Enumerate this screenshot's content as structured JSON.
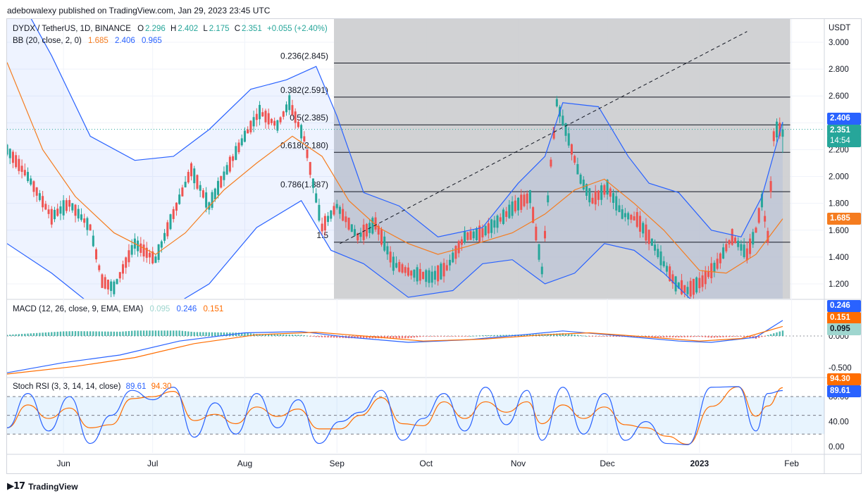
{
  "header": {
    "publisher_text": "adebowalexy published on TradingView.com, Jan 29, 2023 23:45 UTC"
  },
  "footer": {
    "brand": "TradingView"
  },
  "colors": {
    "up": "#26a69a",
    "down": "#ef5350",
    "bb_mid": "#f57c1f",
    "bb_band": "#2962ff",
    "macd": "#2962ff",
    "signal": "#ff6d00",
    "stoch_k": "#2962ff",
    "stoch_d": "#ff6d00",
    "fib_zone": "#c9cacc"
  },
  "main_legend": {
    "symbol": "DYDX / TetherUS, 1D, BINANCE",
    "o_label": "O",
    "o": "2.296",
    "h_label": "H",
    "h": "2.402",
    "l_label": "L",
    "l": "2.175",
    "c_label": "C",
    "c": "2.351",
    "change": "+0.055 (+2.40%)",
    "bb_label": "BB (20, close, 2, 0)",
    "bb_mid": "1.685",
    "bb_upper": "2.406",
    "bb_lower": "0.965"
  },
  "macd_legend": {
    "label": "MACD (12, 26, close, 9, EMA, EMA)",
    "hist": "0.095",
    "macd": "0.246",
    "signal": "0.151"
  },
  "stoch_legend": {
    "label": "Stoch RSI (3, 3, 14, 14, close)",
    "k": "89.61",
    "d": "94.30"
  },
  "price_axis": {
    "unit": "USDT",
    "ticks": [
      "3.000",
      "2.800",
      "2.600",
      "2.400",
      "2.200",
      "2.000",
      "1.800",
      "1.600",
      "1.400",
      "1.200"
    ],
    "tick_values": [
      3.0,
      2.8,
      2.6,
      2.4,
      2.2,
      2.0,
      1.8,
      1.6,
      1.4,
      1.2
    ]
  },
  "macd_axis": {
    "ticks": [
      "0.000",
      "-0.500"
    ],
    "tick_values": [
      0.0,
      -0.5
    ]
  },
  "stoch_axis": {
    "ticks": [
      "80.00",
      "40.00",
      "0.00"
    ],
    "tick_values": [
      80,
      40,
      0
    ],
    "bands": [
      80,
      50,
      20
    ]
  },
  "price_labels": {
    "bb_upper": "2.406",
    "close": "2.351",
    "countdown": "14:54",
    "bb_mid": "1.685",
    "macd": "0.246",
    "signal": "0.151",
    "hist": "0.095",
    "stoch_d": "94.30",
    "stoch_k": "89.61"
  },
  "time_axis": {
    "labels": [
      "Jun",
      "Jul",
      "Aug",
      "Sep",
      "Oct",
      "Nov",
      "Dec",
      "2023",
      "Feb"
    ],
    "dates": [
      "2022-06-01",
      "2022-07-01",
      "2022-08-01",
      "2022-09-01",
      "2022-10-01",
      "2022-11-01",
      "2022-12-01",
      "2023-01-01",
      "2023-02-01"
    ]
  },
  "fib_levels": [
    {
      "label": "0.236(2.845)",
      "value": 2.845
    },
    {
      "label": "0.382(2.591)",
      "value": 2.591
    },
    {
      "label": "0.5(2.385)",
      "value": 2.385
    },
    {
      "label": "0.618(2.180)",
      "value": 2.18
    },
    {
      "label": "0.786(1.887)",
      "value": 1.887
    },
    {
      "label": "1.5",
      "value": 1.51
    }
  ],
  "chart_data": {
    "type": "candlestick",
    "symbol": "DYDX / TetherUS",
    "interval": "1D",
    "y_range": [
      1.15,
      3.1
    ],
    "date_range": [
      "2022-05-13",
      "2023-01-29"
    ],
    "last": {
      "open": 2.296,
      "high": 2.402,
      "low": 2.175,
      "close": 2.351
    },
    "close_path": [
      [
        "2022-05-13",
        2.2
      ],
      [
        "2022-05-20",
        2.0
      ],
      [
        "2022-05-28",
        1.7
      ],
      [
        "2022-06-03",
        1.8
      ],
      [
        "2022-06-10",
        1.62
      ],
      [
        "2022-06-14",
        1.22
      ],
      [
        "2022-06-18",
        1.17
      ],
      [
        "2022-06-25",
        1.5
      ],
      [
        "2022-07-02",
        1.38
      ],
      [
        "2022-07-08",
        1.72
      ],
      [
        "2022-07-14",
        2.05
      ],
      [
        "2022-07-20",
        1.78
      ],
      [
        "2022-07-26",
        2.05
      ],
      [
        "2022-08-01",
        2.3
      ],
      [
        "2022-08-06",
        2.48
      ],
      [
        "2022-08-12",
        2.38
      ],
      [
        "2022-08-16",
        2.55
      ],
      [
        "2022-08-21",
        2.28
      ],
      [
        "2022-08-27",
        1.62
      ],
      [
        "2022-09-01",
        1.78
      ],
      [
        "2022-09-08",
        1.55
      ],
      [
        "2022-09-14",
        1.65
      ],
      [
        "2022-09-20",
        1.35
      ],
      [
        "2022-09-26",
        1.28
      ],
      [
        "2022-10-03",
        1.25
      ],
      [
        "2022-10-08",
        1.32
      ],
      [
        "2022-10-14",
        1.55
      ],
      [
        "2022-10-20",
        1.58
      ],
      [
        "2022-10-26",
        1.68
      ],
      [
        "2022-10-31",
        1.78
      ],
      [
        "2022-11-05",
        1.85
      ],
      [
        "2022-11-09",
        1.3
      ],
      [
        "2022-11-12",
        2.1
      ],
      [
        "2022-11-14",
        2.55
      ],
      [
        "2022-11-17",
        2.35
      ],
      [
        "2022-11-22",
        1.98
      ],
      [
        "2022-11-26",
        1.82
      ],
      [
        "2022-12-01",
        1.92
      ],
      [
        "2022-12-06",
        1.72
      ],
      [
        "2022-12-11",
        1.68
      ],
      [
        "2022-12-15",
        1.55
      ],
      [
        "2022-12-20",
        1.35
      ],
      [
        "2022-12-24",
        1.2
      ],
      [
        "2022-12-28",
        1.15
      ],
      [
        "2023-01-02",
        1.22
      ],
      [
        "2023-01-07",
        1.35
      ],
      [
        "2023-01-12",
        1.55
      ],
      [
        "2023-01-17",
        1.42
      ],
      [
        "2023-01-20",
        1.6
      ],
      [
        "2023-01-22",
        1.82
      ],
      [
        "2023-01-24",
        1.55
      ],
      [
        "2023-01-26",
        2.3
      ],
      [
        "2023-01-27",
        2.35
      ],
      [
        "2023-01-29",
        2.351
      ]
    ],
    "bollinger_mid": [
      [
        "2022-05-13",
        2.85
      ],
      [
        "2022-05-25",
        2.2
      ],
      [
        "2022-06-05",
        1.85
      ],
      [
        "2022-06-18",
        1.58
      ],
      [
        "2022-07-02",
        1.42
      ],
      [
        "2022-07-12",
        1.58
      ],
      [
        "2022-07-25",
        1.9
      ],
      [
        "2022-08-05",
        2.1
      ],
      [
        "2022-08-17",
        2.3
      ],
      [
        "2022-08-27",
        2.15
      ],
      [
        "2022-09-05",
        1.82
      ],
      [
        "2022-09-15",
        1.62
      ],
      [
        "2022-09-25",
        1.5
      ],
      [
        "2022-10-05",
        1.42
      ],
      [
        "2022-10-15",
        1.48
      ],
      [
        "2022-10-30",
        1.58
      ],
      [
        "2022-11-10",
        1.72
      ],
      [
        "2022-11-20",
        1.9
      ],
      [
        "2022-11-30",
        1.98
      ],
      [
        "2022-12-10",
        1.8
      ],
      [
        "2022-12-20",
        1.6
      ],
      [
        "2023-01-01",
        1.3
      ],
      [
        "2023-01-10",
        1.28
      ],
      [
        "2023-01-20",
        1.42
      ],
      [
        "2023-01-29",
        1.685
      ]
    ],
    "bollinger_upper": [
      [
        "2022-05-13",
        3.5
      ],
      [
        "2022-05-28",
        2.9
      ],
      [
        "2022-06-10",
        2.3
      ],
      [
        "2022-06-25",
        2.12
      ],
      [
        "2022-07-08",
        2.15
      ],
      [
        "2022-07-20",
        2.35
      ],
      [
        "2022-08-03",
        2.65
      ],
      [
        "2022-08-15",
        2.72
      ],
      [
        "2022-08-25",
        2.82
      ],
      [
        "2022-09-01",
        2.45
      ],
      [
        "2022-09-10",
        1.88
      ],
      [
        "2022-09-22",
        1.78
      ],
      [
        "2022-10-05",
        1.55
      ],
      [
        "2022-10-20",
        1.62
      ],
      [
        "2022-11-01",
        1.95
      ],
      [
        "2022-11-10",
        2.15
      ],
      [
        "2022-11-16",
        2.55
      ],
      [
        "2022-11-28",
        2.52
      ],
      [
        "2022-12-08",
        2.15
      ],
      [
        "2022-12-15",
        1.95
      ],
      [
        "2022-12-25",
        1.88
      ],
      [
        "2023-01-05",
        1.6
      ],
      [
        "2023-01-15",
        1.55
      ],
      [
        "2023-01-22",
        1.85
      ],
      [
        "2023-01-29",
        2.406
      ]
    ],
    "bollinger_lower": [
      [
        "2022-05-13",
        1.5
      ],
      [
        "2022-05-28",
        1.28
      ],
      [
        "2022-06-10",
        1.05
      ],
      [
        "2022-06-20",
        0.98
      ],
      [
        "2022-07-05",
        1.0
      ],
      [
        "2022-07-20",
        1.2
      ],
      [
        "2022-08-05",
        1.62
      ],
      [
        "2022-08-20",
        1.82
      ],
      [
        "2022-08-30",
        1.45
      ],
      [
        "2022-09-10",
        1.35
      ],
      [
        "2022-09-25",
        1.1
      ],
      [
        "2022-10-10",
        1.15
      ],
      [
        "2022-10-20",
        1.35
      ],
      [
        "2022-10-30",
        1.38
      ],
      [
        "2022-11-10",
        1.2
      ],
      [
        "2022-11-20",
        1.28
      ],
      [
        "2022-11-30",
        1.5
      ],
      [
        "2022-12-10",
        1.45
      ],
      [
        "2022-12-20",
        1.28
      ],
      [
        "2023-01-01",
        1.02
      ],
      [
        "2023-01-15",
        1.0
      ],
      [
        "2023-01-29",
        0.965
      ]
    ],
    "fib_zone": {
      "from_date": "2022-08-31",
      "to_date": "2023-01-29"
    },
    "trend_line": [
      [
        "2022-09-02",
        1.5
      ],
      [
        "2023-01-17",
        3.08
      ]
    ],
    "macd": {
      "y_range": [
        -0.6,
        0.3
      ],
      "macd_line": [
        [
          "2022-05-13",
          -0.58
        ],
        [
          "2022-06-01",
          -0.42
        ],
        [
          "2022-06-20",
          -0.3
        ],
        [
          "2022-07-10",
          -0.08
        ],
        [
          "2022-08-01",
          0.05
        ],
        [
          "2022-08-20",
          0.07
        ],
        [
          "2022-09-05",
          -0.02
        ],
        [
          "2022-09-25",
          -0.1
        ],
        [
          "2022-10-15",
          -0.06
        ],
        [
          "2022-11-05",
          0.03
        ],
        [
          "2022-11-16",
          0.08
        ],
        [
          "2022-12-01",
          0.02
        ],
        [
          "2022-12-25",
          -0.08
        ],
        [
          "2023-01-05",
          -0.1
        ],
        [
          "2023-01-20",
          -0.02
        ],
        [
          "2023-01-29",
          0.246
        ]
      ],
      "signal_line": [
        [
          "2022-05-13",
          -0.6
        ],
        [
          "2022-06-05",
          -0.48
        ],
        [
          "2022-06-25",
          -0.34
        ],
        [
          "2022-07-15",
          -0.12
        ],
        [
          "2022-08-05",
          0.02
        ],
        [
          "2022-08-25",
          0.06
        ],
        [
          "2022-09-10",
          0.0
        ],
        [
          "2022-09-30",
          -0.08
        ],
        [
          "2022-10-20",
          -0.05
        ],
        [
          "2022-11-10",
          0.02
        ],
        [
          "2022-11-25",
          0.05
        ],
        [
          "2022-12-10",
          0.0
        ],
        [
          "2023-01-01",
          -0.08
        ],
        [
          "2023-01-15",
          -0.04
        ],
        [
          "2023-01-29",
          0.151
        ]
      ],
      "histogram_last": 0.095
    },
    "stoch_rsi": {
      "y_range": [
        0,
        100
      ],
      "k_last": 89.61,
      "d_last": 94.3,
      "k_series": [
        [
          "2022-05-13",
          30
        ],
        [
          "2022-05-20",
          85
        ],
        [
          "2022-05-27",
          25
        ],
        [
          "2022-06-03",
          80
        ],
        [
          "2022-06-10",
          5
        ],
        [
          "2022-06-17",
          50
        ],
        [
          "2022-06-24",
          90
        ],
        [
          "2022-07-01",
          75
        ],
        [
          "2022-07-08",
          95
        ],
        [
          "2022-07-15",
          15
        ],
        [
          "2022-07-22",
          70
        ],
        [
          "2022-07-29",
          20
        ],
        [
          "2022-08-05",
          85
        ],
        [
          "2022-08-12",
          30
        ],
        [
          "2022-08-19",
          75
        ],
        [
          "2022-08-26",
          5
        ],
        [
          "2022-09-02",
          40
        ],
        [
          "2022-09-09",
          55
        ],
        [
          "2022-09-16",
          90
        ],
        [
          "2022-09-23",
          10
        ],
        [
          "2022-09-30",
          45
        ],
        [
          "2022-10-07",
          85
        ],
        [
          "2022-10-14",
          25
        ],
        [
          "2022-10-21",
          95
        ],
        [
          "2022-10-28",
          35
        ],
        [
          "2022-11-04",
          90
        ],
        [
          "2022-11-09",
          10
        ],
        [
          "2022-11-16",
          95
        ],
        [
          "2022-11-23",
          20
        ],
        [
          "2022-11-30",
          85
        ],
        [
          "2022-12-07",
          10
        ],
        [
          "2022-12-14",
          40
        ],
        [
          "2022-12-21",
          5
        ],
        [
          "2022-12-28",
          3
        ],
        [
          "2023-01-05",
          95
        ],
        [
          "2023-01-14",
          96
        ],
        [
          "2023-01-20",
          25
        ],
        [
          "2023-01-24",
          85
        ],
        [
          "2023-01-29",
          89.61
        ]
      ]
    }
  }
}
